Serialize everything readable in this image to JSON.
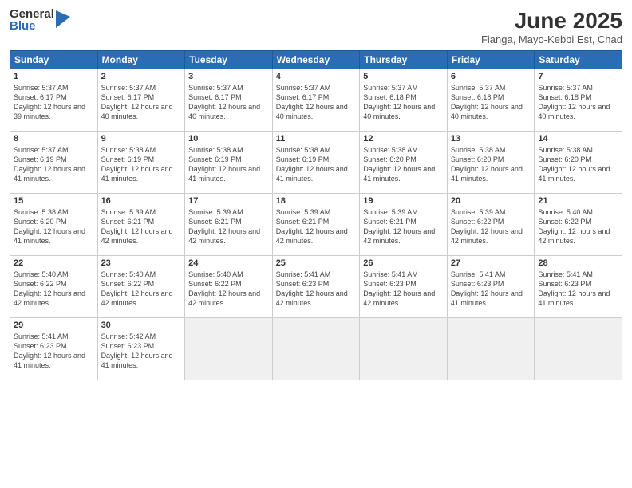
{
  "logo": {
    "general": "General",
    "blue": "Blue"
  },
  "title": "June 2025",
  "location": "Fianga, Mayo-Kebbi Est, Chad",
  "days_of_week": [
    "Sunday",
    "Monday",
    "Tuesday",
    "Wednesday",
    "Thursday",
    "Friday",
    "Saturday"
  ],
  "weeks": [
    [
      {
        "day": 1,
        "info": "Sunrise: 5:37 AM\nSunset: 6:17 PM\nDaylight: 12 hours and 39 minutes."
      },
      {
        "day": 2,
        "info": "Sunrise: 5:37 AM\nSunset: 6:17 PM\nDaylight: 12 hours and 40 minutes."
      },
      {
        "day": 3,
        "info": "Sunrise: 5:37 AM\nSunset: 6:17 PM\nDaylight: 12 hours and 40 minutes."
      },
      {
        "day": 4,
        "info": "Sunrise: 5:37 AM\nSunset: 6:17 PM\nDaylight: 12 hours and 40 minutes."
      },
      {
        "day": 5,
        "info": "Sunrise: 5:37 AM\nSunset: 6:18 PM\nDaylight: 12 hours and 40 minutes."
      },
      {
        "day": 6,
        "info": "Sunrise: 5:37 AM\nSunset: 6:18 PM\nDaylight: 12 hours and 40 minutes."
      },
      {
        "day": 7,
        "info": "Sunrise: 5:37 AM\nSunset: 6:18 PM\nDaylight: 12 hours and 40 minutes."
      }
    ],
    [
      {
        "day": 8,
        "info": "Sunrise: 5:37 AM\nSunset: 6:19 PM\nDaylight: 12 hours and 41 minutes."
      },
      {
        "day": 9,
        "info": "Sunrise: 5:38 AM\nSunset: 6:19 PM\nDaylight: 12 hours and 41 minutes."
      },
      {
        "day": 10,
        "info": "Sunrise: 5:38 AM\nSunset: 6:19 PM\nDaylight: 12 hours and 41 minutes."
      },
      {
        "day": 11,
        "info": "Sunrise: 5:38 AM\nSunset: 6:19 PM\nDaylight: 12 hours and 41 minutes."
      },
      {
        "day": 12,
        "info": "Sunrise: 5:38 AM\nSunset: 6:20 PM\nDaylight: 12 hours and 41 minutes."
      },
      {
        "day": 13,
        "info": "Sunrise: 5:38 AM\nSunset: 6:20 PM\nDaylight: 12 hours and 41 minutes."
      },
      {
        "day": 14,
        "info": "Sunrise: 5:38 AM\nSunset: 6:20 PM\nDaylight: 12 hours and 41 minutes."
      }
    ],
    [
      {
        "day": 15,
        "info": "Sunrise: 5:38 AM\nSunset: 6:20 PM\nDaylight: 12 hours and 41 minutes."
      },
      {
        "day": 16,
        "info": "Sunrise: 5:39 AM\nSunset: 6:21 PM\nDaylight: 12 hours and 42 minutes."
      },
      {
        "day": 17,
        "info": "Sunrise: 5:39 AM\nSunset: 6:21 PM\nDaylight: 12 hours and 42 minutes."
      },
      {
        "day": 18,
        "info": "Sunrise: 5:39 AM\nSunset: 6:21 PM\nDaylight: 12 hours and 42 minutes."
      },
      {
        "day": 19,
        "info": "Sunrise: 5:39 AM\nSunset: 6:21 PM\nDaylight: 12 hours and 42 minutes."
      },
      {
        "day": 20,
        "info": "Sunrise: 5:39 AM\nSunset: 6:22 PM\nDaylight: 12 hours and 42 minutes."
      },
      {
        "day": 21,
        "info": "Sunrise: 5:40 AM\nSunset: 6:22 PM\nDaylight: 12 hours and 42 minutes."
      }
    ],
    [
      {
        "day": 22,
        "info": "Sunrise: 5:40 AM\nSunset: 6:22 PM\nDaylight: 12 hours and 42 minutes."
      },
      {
        "day": 23,
        "info": "Sunrise: 5:40 AM\nSunset: 6:22 PM\nDaylight: 12 hours and 42 minutes."
      },
      {
        "day": 24,
        "info": "Sunrise: 5:40 AM\nSunset: 6:22 PM\nDaylight: 12 hours and 42 minutes."
      },
      {
        "day": 25,
        "info": "Sunrise: 5:41 AM\nSunset: 6:23 PM\nDaylight: 12 hours and 42 minutes."
      },
      {
        "day": 26,
        "info": "Sunrise: 5:41 AM\nSunset: 6:23 PM\nDaylight: 12 hours and 42 minutes."
      },
      {
        "day": 27,
        "info": "Sunrise: 5:41 AM\nSunset: 6:23 PM\nDaylight: 12 hours and 41 minutes."
      },
      {
        "day": 28,
        "info": "Sunrise: 5:41 AM\nSunset: 6:23 PM\nDaylight: 12 hours and 41 minutes."
      }
    ],
    [
      {
        "day": 29,
        "info": "Sunrise: 5:41 AM\nSunset: 6:23 PM\nDaylight: 12 hours and 41 minutes."
      },
      {
        "day": 30,
        "info": "Sunrise: 5:42 AM\nSunset: 6:23 PM\nDaylight: 12 hours and 41 minutes."
      },
      null,
      null,
      null,
      null,
      null
    ]
  ]
}
